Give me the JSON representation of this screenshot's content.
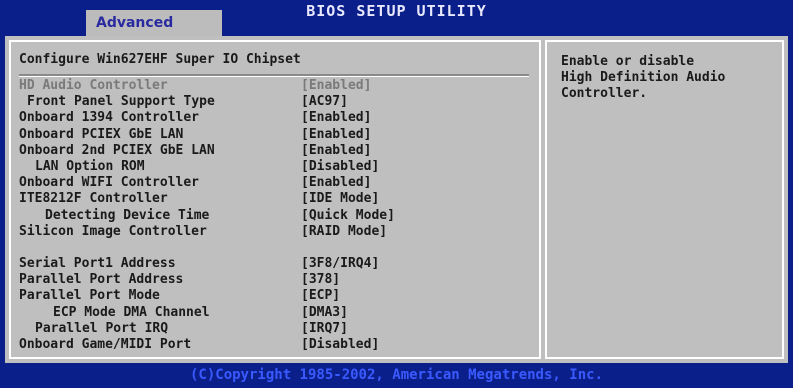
{
  "header": {
    "title": "BIOS SETUP UTILITY",
    "active_tab": "Advanced"
  },
  "main": {
    "section_title": "Configure Win627EHF Super IO Chipset",
    "settings": [
      {
        "label": "HD Audio Controller",
        "indent": 0,
        "value": "[Enabled]",
        "dim": true
      },
      {
        "label": "Front Panel Support Type",
        "indent": 1,
        "value": "[AC97]",
        "dim": false
      },
      {
        "label": "Onboard 1394 Controller",
        "indent": 0,
        "value": "[Enabled]",
        "dim": false
      },
      {
        "label": "Onboard PCIEX GbE LAN",
        "indent": 0,
        "value": "[Enabled]",
        "dim": false
      },
      {
        "label": "Onboard 2nd PCIEX GbE LAN",
        "indent": 0,
        "value": "[Enabled]",
        "dim": false
      },
      {
        "label": "LAN Option ROM",
        "indent": 2,
        "value": "[Disabled]",
        "dim": false
      },
      {
        "label": "Onboard WIFI Controller",
        "indent": 0,
        "value": "[Enabled]",
        "dim": false
      },
      {
        "label": "ITE8212F Controller",
        "indent": 0,
        "value": "[IDE Mode]",
        "dim": false
      },
      {
        "label": "Detecting Device Time",
        "indent": 3,
        "value": "[Quick Mode]",
        "dim": false
      },
      {
        "label": "Silicon Image Controller",
        "indent": 0,
        "value": "[RAID Mode]",
        "dim": false
      },
      {
        "label": "",
        "indent": 0,
        "value": "",
        "dim": false
      },
      {
        "label": "Serial Port1 Address",
        "indent": 0,
        "value": "[3F8/IRQ4]",
        "dim": false
      },
      {
        "label": "Parallel Port Address",
        "indent": 0,
        "value": "[378]",
        "dim": false
      },
      {
        "label": "Parallel Port Mode",
        "indent": 0,
        "value": "[ECP]",
        "dim": false
      },
      {
        "label": "ECP Mode DMA Channel",
        "indent": 4,
        "value": "[DMA3]",
        "dim": false
      },
      {
        "label": "Parallel Port IRQ",
        "indent": 2,
        "value": "[IRQ7]",
        "dim": false
      },
      {
        "label": "Onboard Game/MIDI Port",
        "indent": 0,
        "value": "[Disabled]",
        "dim": false
      }
    ]
  },
  "help": {
    "lines": [
      "Enable or disable",
      "High Definition Audio",
      "Controller."
    ]
  },
  "footer": {
    "copyright": "(C)Copyright 1985-2002, American Megatrends, Inc."
  }
}
